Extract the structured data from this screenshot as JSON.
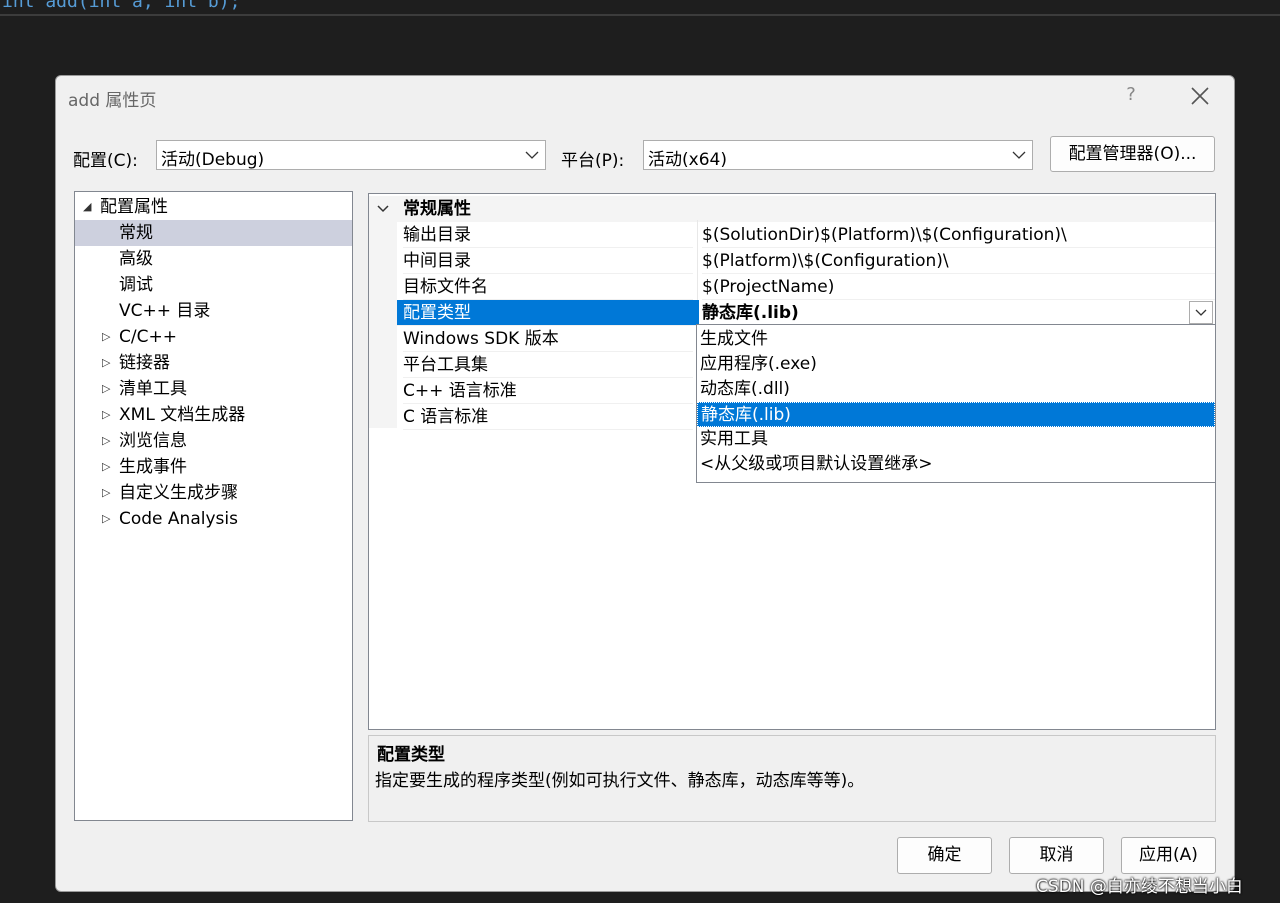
{
  "editor": {
    "code_line": "int add(int a, int b);"
  },
  "dialog": {
    "title": "add 属性页",
    "help": "?",
    "config_label": "配置(C):",
    "config_value": "活动(Debug)",
    "platform_label": "平台(P):",
    "platform_value": "活动(x64)",
    "config_manager_button": "配置管理器(O)..."
  },
  "tree": {
    "root": "配置属性",
    "items": [
      {
        "label": "常规",
        "expandable": false,
        "selected": true
      },
      {
        "label": "高级",
        "expandable": false
      },
      {
        "label": "调试",
        "expandable": false
      },
      {
        "label": "VC++ 目录",
        "expandable": false
      },
      {
        "label": "C/C++",
        "expandable": true
      },
      {
        "label": "链接器",
        "expandable": true
      },
      {
        "label": "清单工具",
        "expandable": true
      },
      {
        "label": "XML 文档生成器",
        "expandable": true
      },
      {
        "label": "浏览信息",
        "expandable": true
      },
      {
        "label": "生成事件",
        "expandable": true
      },
      {
        "label": "自定义生成步骤",
        "expandable": true
      },
      {
        "label": "Code Analysis",
        "expandable": true
      }
    ]
  },
  "grid": {
    "section": "常规属性",
    "rows": [
      {
        "name": "输出目录",
        "value": "$(SolutionDir)$(Platform)\\$(Configuration)\\"
      },
      {
        "name": "中间目录",
        "value": "$(Platform)\\$(Configuration)\\"
      },
      {
        "name": "目标文件名",
        "value": "$(ProjectName)"
      },
      {
        "name": "配置类型",
        "value": "静态库(.lib)",
        "selected": true
      },
      {
        "name": "Windows SDK 版本",
        "value": ""
      },
      {
        "name": "平台工具集",
        "value": ""
      },
      {
        "name": "C++ 语言标准",
        "value": ""
      },
      {
        "name": "C 语言标准",
        "value": ""
      }
    ]
  },
  "dropdown": {
    "options": [
      "生成文件",
      "应用程序(.exe)",
      "动态库(.dll)",
      "静态库(.lib)",
      "实用工具",
      "<从父级或项目默认设置继承>"
    ],
    "selected": "静态库(.lib)"
  },
  "description": {
    "title": "配置类型",
    "text": "指定要生成的程序类型(例如可执行文件、静态库，动态库等等)。"
  },
  "buttons": {
    "ok": "确定",
    "cancel": "取消",
    "apply": "应用(A)"
  },
  "watermark": "CSDN @白亦绫不想当小白",
  "colors": {
    "selection": "#0078d7",
    "tree_selection": "#cdd0de",
    "dialog_bg": "#f0f0f0"
  }
}
